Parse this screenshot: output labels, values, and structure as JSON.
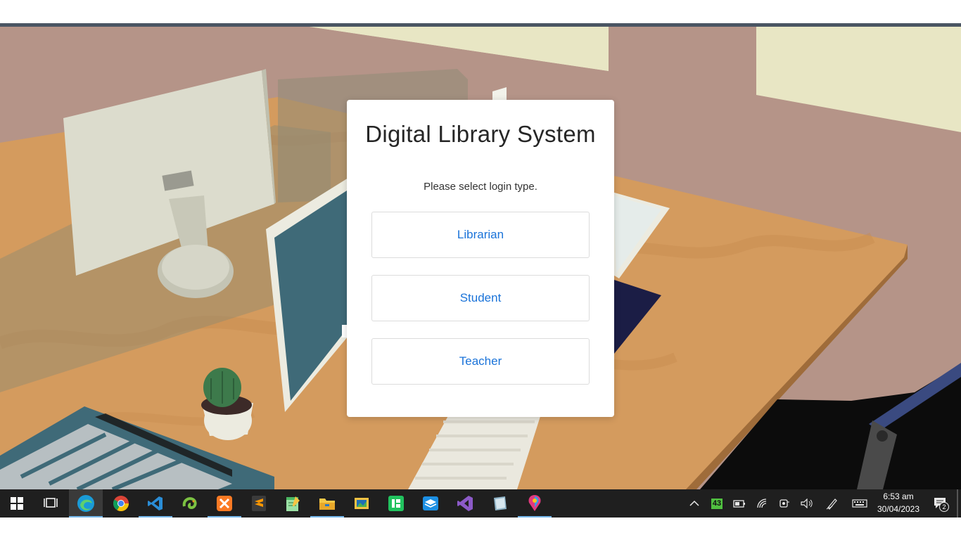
{
  "login": {
    "title": "Digital Library System",
    "subtitle": "Please select login type.",
    "options": [
      "Librarian",
      "Student",
      "Teacher"
    ]
  },
  "taskbar": {
    "apps": [
      {
        "name": "Microsoft Edge",
        "icon": "edge-icon",
        "active": true
      },
      {
        "name": "Google Chrome",
        "icon": "chrome-icon"
      },
      {
        "name": "Visual Studio Code",
        "icon": "vscode-icon",
        "running": true
      },
      {
        "name": "Chameleon",
        "icon": "chameleon-icon"
      },
      {
        "name": "XAMPP",
        "icon": "xampp-icon",
        "running": true
      },
      {
        "name": "Sublime Text",
        "icon": "sublime-icon"
      },
      {
        "name": "Notepad",
        "icon": "notepad-icon"
      },
      {
        "name": "File Explorer",
        "icon": "folder-icon",
        "running": true
      },
      {
        "name": "Photos",
        "icon": "photos-icon"
      },
      {
        "name": "Android Studio",
        "icon": "green-app-icon"
      },
      {
        "name": "Mail",
        "icon": "mail-icon"
      },
      {
        "name": "Visual Studio",
        "icon": "visual-studio-icon"
      },
      {
        "name": "Tablet tool",
        "icon": "tablet-icon"
      },
      {
        "name": "Paint 3D",
        "icon": "paint-icon",
        "running": true
      }
    ],
    "tray": {
      "badge": "43",
      "time": "6:53 am",
      "date": "30/04/2023",
      "notifications": "2"
    }
  },
  "colors": {
    "wall": "#b59488",
    "desk": "#d49b5e",
    "button_text": "#1a73d9",
    "taskbar": "#1f1f1f",
    "accent": "#76b9ed"
  }
}
